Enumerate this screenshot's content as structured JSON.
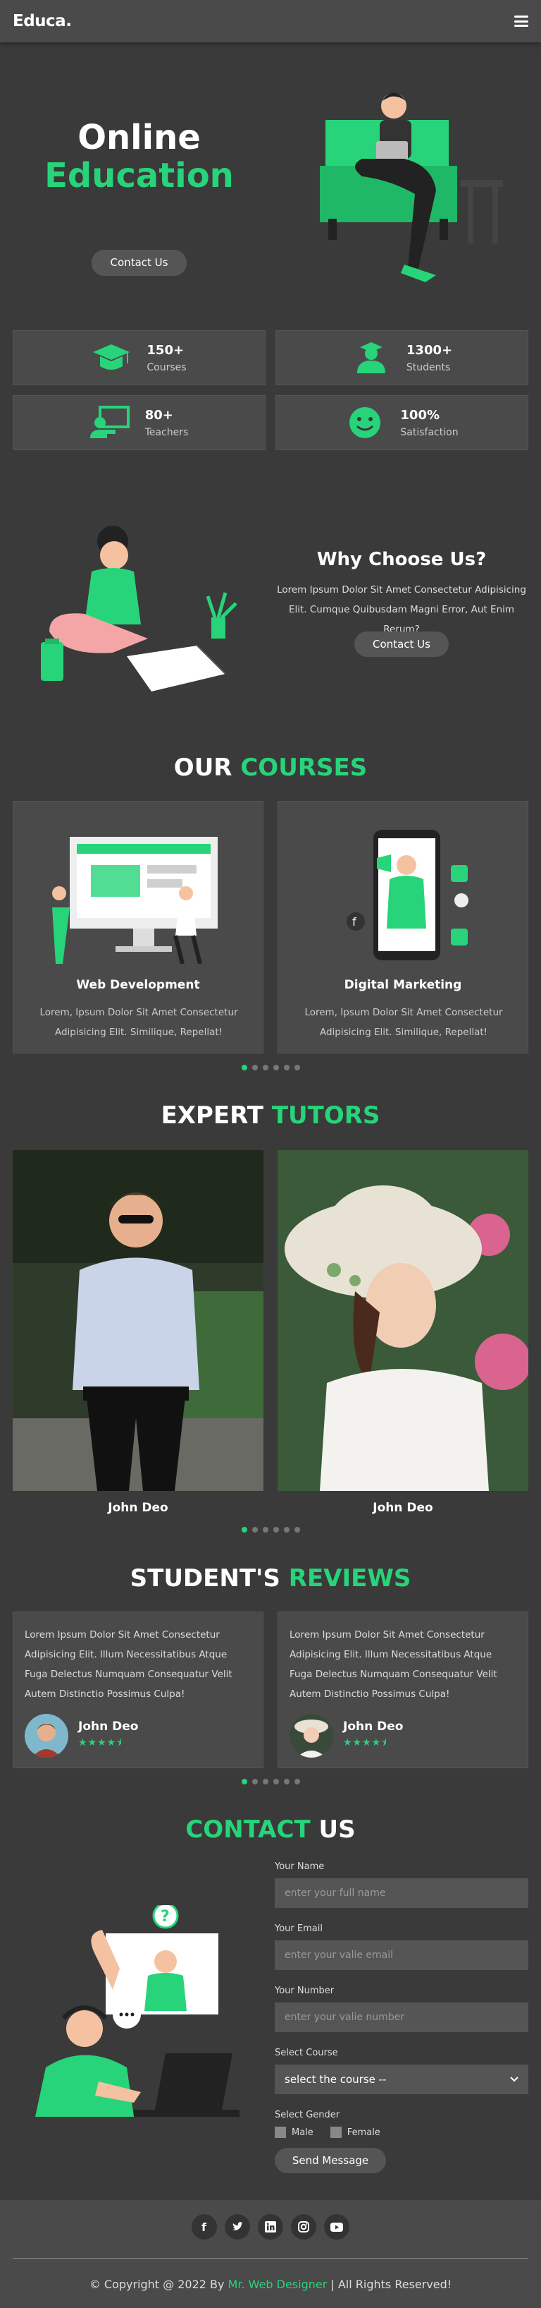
{
  "header": {
    "logo": "Educa.",
    "menu_icon": "hamburger-icon"
  },
  "hero": {
    "title_line1": "Online",
    "title_line2": "Education",
    "button": "Contact Us"
  },
  "stats": [
    {
      "number": "150+",
      "label": "Courses",
      "icon": "graduation-cap-icon"
    },
    {
      "number": "1300+",
      "label": "Students",
      "icon": "student-icon"
    },
    {
      "number": "80+",
      "label": "Teachers",
      "icon": "teacher-icon"
    },
    {
      "number": "100%",
      "label": "Satisfaction",
      "icon": "smile-icon"
    }
  ],
  "why": {
    "title": "Why Choose Us?",
    "text": "Lorem Ipsum Dolor Sit Amet Consectetur Adipisicing Elit. Cumque Quibusdam Magni Error, Aut Enim Rerum?",
    "button": "Contact Us"
  },
  "courses": {
    "title_a": "OUR",
    "title_b": "COURSES",
    "items": [
      {
        "name": "Web Development",
        "desc": "Lorem, Ipsum Dolor Sit Amet Consectetur Adipisicing Elit. Similique, Repellat!"
      },
      {
        "name": "Digital Marketing",
        "desc": "Lorem, Ipsum Dolor Sit Amet Consectetur Adipisicing Elit. Similique, Repellat!"
      }
    ]
  },
  "tutors": {
    "title_a": "EXPERT",
    "title_b": "TUTORS",
    "items": [
      {
        "name": "John Deo"
      },
      {
        "name": "John Deo"
      }
    ]
  },
  "reviews": {
    "title_a": "STUDENT'S",
    "title_b": "REVIEWS",
    "items": [
      {
        "text": "Lorem Ipsum Dolor Sit Amet Consectetur Adipisicing Elit. Illum Necessitatibus Atque Fuga Delectus Numquam Consequatur Velit Autem Distinctio Possimus Culpa!",
        "name": "John Deo",
        "stars": "★★★★⯨"
      },
      {
        "text": "Lorem Ipsum Dolor Sit Amet Consectetur Adipisicing Elit. Illum Necessitatibus Atque Fuga Delectus Numquam Consequatur Velit Autem Distinctio Possimus Culpa!",
        "name": "John Deo",
        "stars": "★★★★⯨"
      }
    ]
  },
  "contact": {
    "title_a": "CONTACT",
    "title_b": "US",
    "name_label": "Your Name",
    "name_placeholder": "enter your full name",
    "email_label": "Your Email",
    "email_placeholder": "enter your valie email",
    "number_label": "Your Number",
    "number_placeholder": "enter your valie number",
    "course_label": "Select Course",
    "course_value": "select the course --",
    "gender_label": "Select Gender",
    "male": "Male",
    "female": "Female",
    "button": "Send Message"
  },
  "footer": {
    "socials": [
      "facebook-icon",
      "twitter-icon",
      "linkedin-icon",
      "instagram-icon",
      "youtube-icon"
    ],
    "copy_prefix": "© Copyright @ 2022 By",
    "copy_link": "Mr. Web Designer",
    "copy_suffix": "| All Rights Reserved!"
  },
  "colors": {
    "accent": "#27d47a",
    "background": "#3a3a3a",
    "card": "#4a4a4a"
  }
}
